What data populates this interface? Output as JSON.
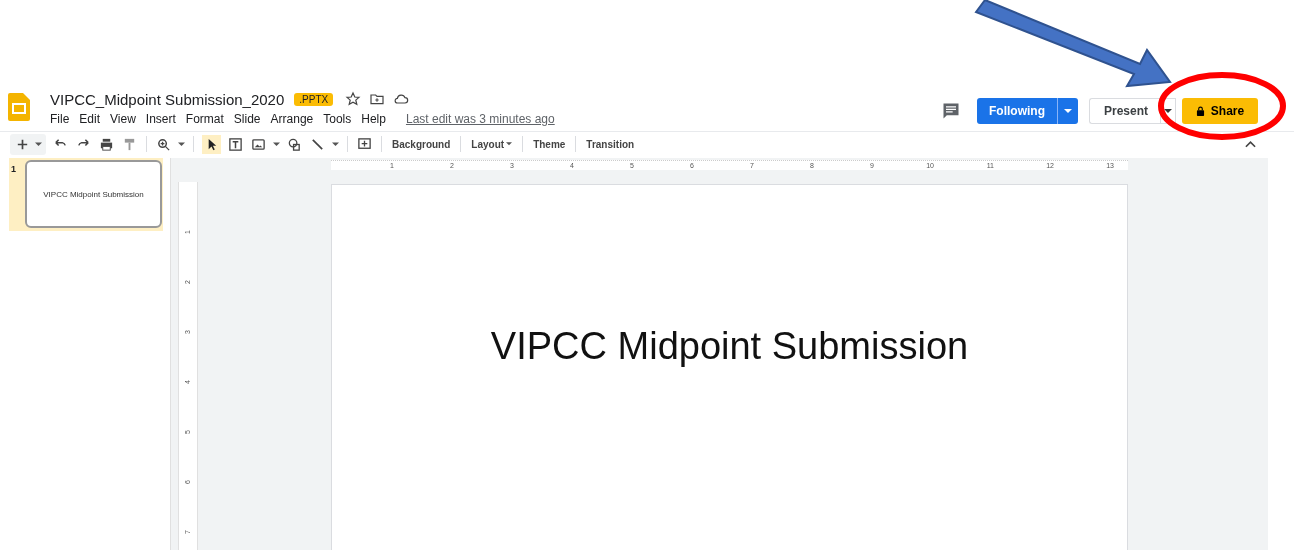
{
  "document": {
    "title": "VIPCC_Midpoint Submission_2020",
    "badge": ".PPTX",
    "last_edit": "Last edit was 3 minutes ago"
  },
  "menu": [
    "File",
    "Edit",
    "View",
    "Insert",
    "Format",
    "Slide",
    "Arrange",
    "Tools",
    "Help"
  ],
  "header_buttons": {
    "following": "Following",
    "present": "Present",
    "share": "Share"
  },
  "toolbar": {
    "text_buttons": [
      {
        "label": "Background",
        "kind": "plain"
      },
      {
        "label": "Layout",
        "kind": "dropdown"
      },
      {
        "label": "Theme",
        "kind": "plain"
      },
      {
        "label": "Transition",
        "kind": "plain"
      }
    ]
  },
  "filmstrip": [
    {
      "number": "1",
      "title": "VIPCC Midpoint Submission",
      "selected": true
    }
  ],
  "ruler": {
    "horizontal": [
      "1",
      "2",
      "3",
      "4",
      "5",
      "6",
      "7",
      "8",
      "9",
      "10",
      "11",
      "12",
      "13"
    ],
    "vertical": [
      "1",
      "2",
      "3",
      "4",
      "5",
      "6",
      "7"
    ]
  },
  "slide": {
    "title": "VIPCC Midpoint Submission"
  }
}
